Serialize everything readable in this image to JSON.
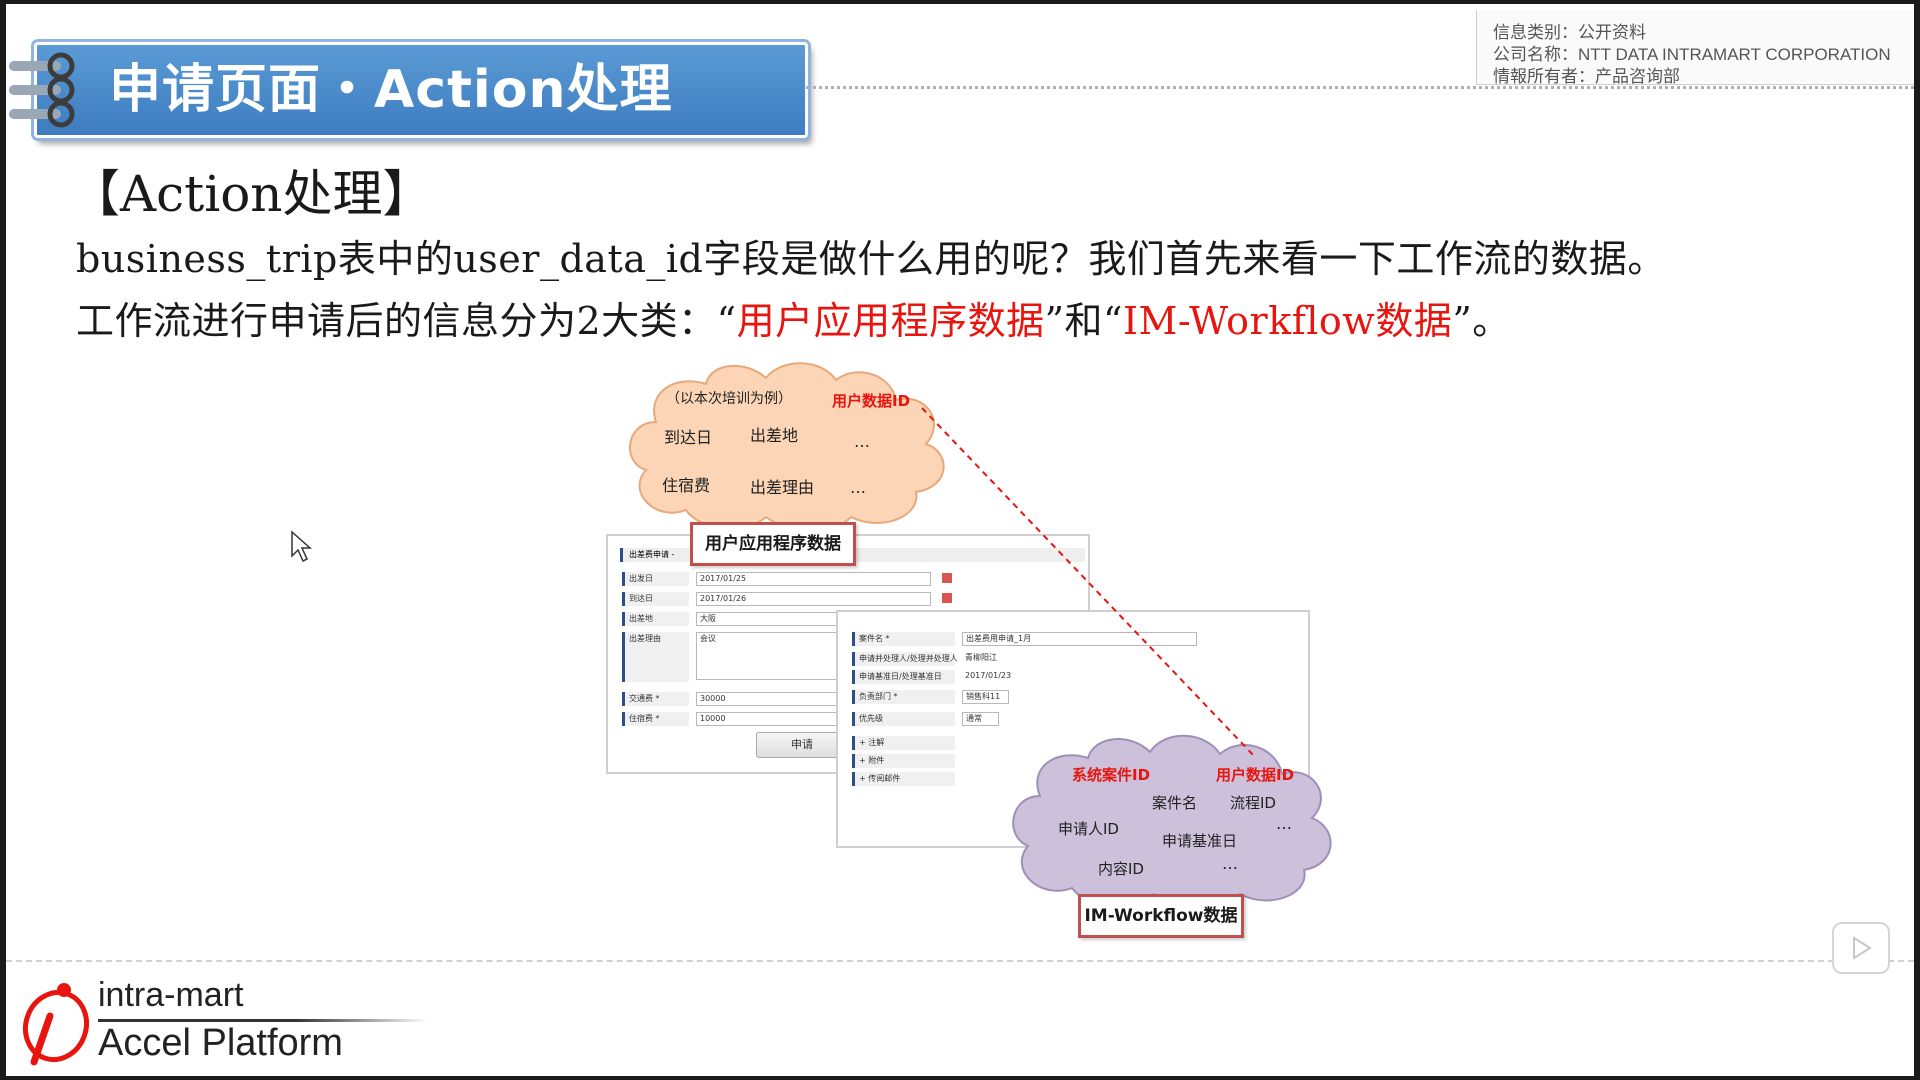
{
  "header": {
    "title": "申请页面・Action处理"
  },
  "info": {
    "line1": "信息类别：公开资料",
    "line2": "公司名称：NTT DATA INTRAMART CORPORATION",
    "line3": "情報所有者：产品咨询部"
  },
  "body": {
    "section_heading": "【Action处理】",
    "line1": "business_trip表中的user_data_id字段是做什么用的呢？我们首先来看一下工作流的数据。",
    "line2_prefix": "工作流进行申请后的信息分为2大类：“",
    "line2_red1": "用户应用程序数据",
    "line2_mid": "”和“",
    "line2_red2": "IM-Workflow数据",
    "line2_suffix": "”。"
  },
  "diagram": {
    "top_cloud": {
      "note": "（以本次培训为例）",
      "user_data_id": "用户数据ID",
      "item1": "到达日",
      "item2": "出差地",
      "item3": "住宿费",
      "item4": "出差理由",
      "ellipsis1": "…",
      "ellipsis2": "…"
    },
    "user_app_label": "用户应用程序数据",
    "form1": {
      "title": "出差费申请 -",
      "rows": [
        {
          "label": "出发日",
          "value": "2017/01/25"
        },
        {
          "label": "到达日",
          "value": "2017/01/26"
        },
        {
          "label": "出差地",
          "value": "大阪"
        },
        {
          "label": "出差理由",
          "value": "会议"
        },
        {
          "label": "交通费 *",
          "value": "30000"
        },
        {
          "label": "住宿费 *",
          "value": "10000"
        }
      ],
      "submit": "申请"
    },
    "form2": {
      "rows": [
        {
          "label": "案件名 *",
          "value": "出差费用申请_1月"
        },
        {
          "label": "申请并处理人/处理并处理人",
          "value": "青柳阳江"
        },
        {
          "label": "申请基准日/处理基准日",
          "value": "2017/01/23"
        },
        {
          "label": "负责部门 *",
          "value": "销售科11"
        },
        {
          "label": "优先级",
          "value": "通常"
        },
        {
          "label": "+ 注解",
          "value": ""
        },
        {
          "label": "+ 附件",
          "value": ""
        },
        {
          "label": "+ 传阅邮件",
          "value": ""
        }
      ]
    },
    "bottom_cloud": {
      "system_case_id": "系统案件ID",
      "user_data_id": "用户数据ID",
      "case_name": "案件名",
      "flow_id": "流程ID",
      "applicant_id": "申请人ID",
      "apply_base_date": "申请基准日",
      "content_id": "内容ID",
      "ellipsis1": "…",
      "ellipsis2": "…"
    },
    "im_workflow_label": "IM-Workflow数据"
  },
  "footer": {
    "logo_line1": "intra-mart",
    "logo_line2": "Accel Platform"
  },
  "colors": {
    "banner": "#4a8ccb",
    "red_text": "#e8150f",
    "top_cloud_fill": "#fbd5b5",
    "bottom_cloud_fill": "#ccc0da",
    "label_border": "#c0504d",
    "logo_red": "#e8150f"
  }
}
